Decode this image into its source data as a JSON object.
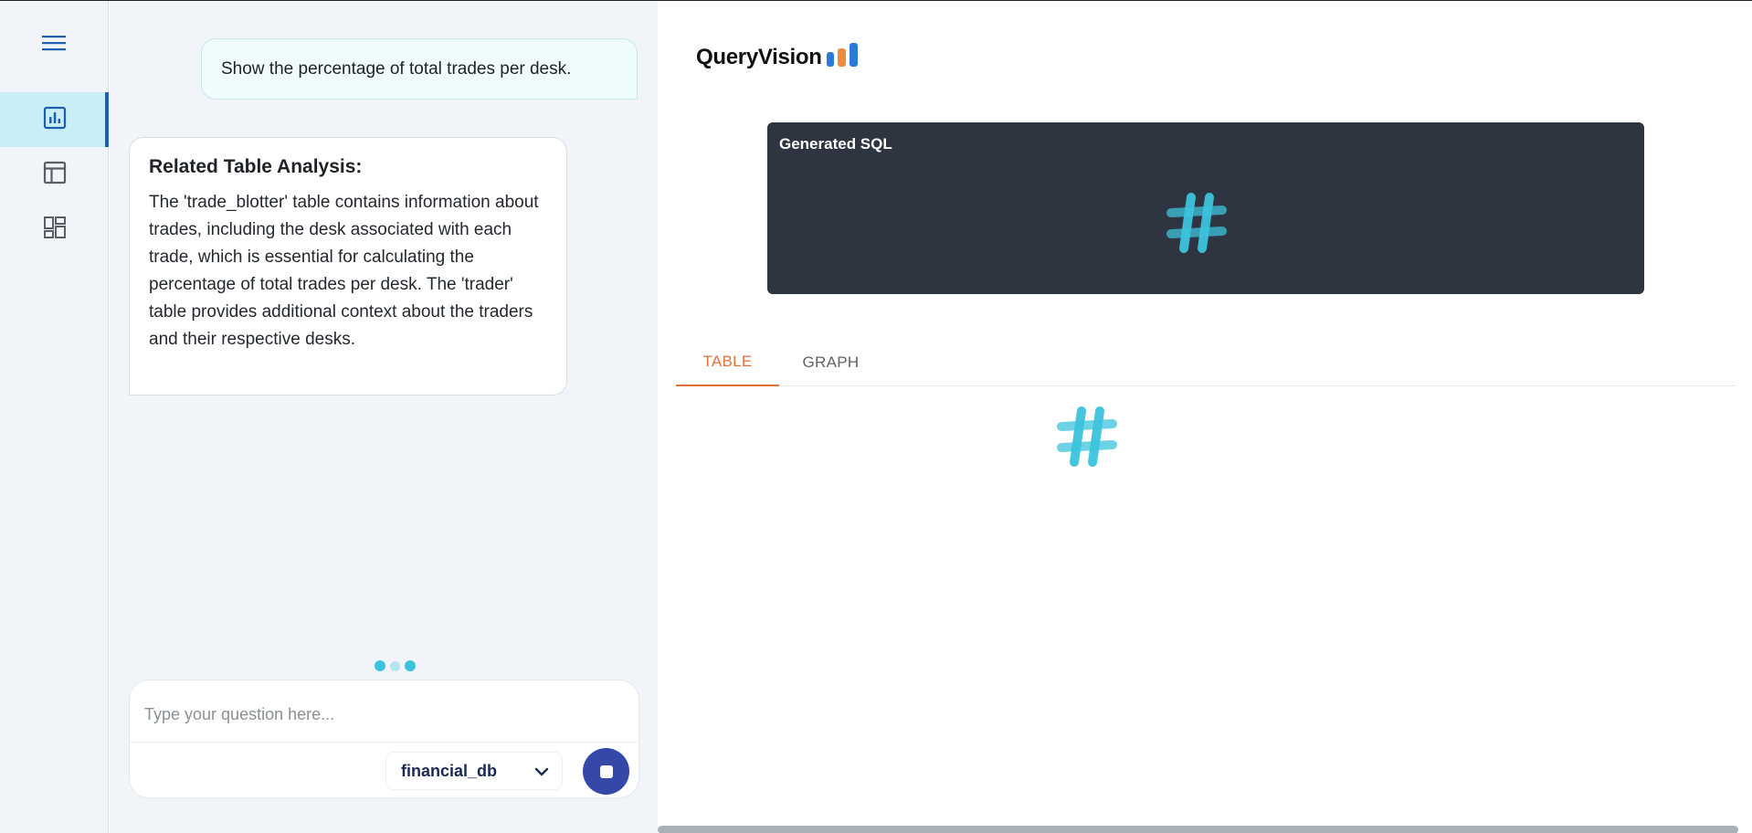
{
  "sidebar": {
    "menu_icon": "hamburger-menu-icon",
    "items": [
      {
        "icon": "bar-chart-icon",
        "active": true
      },
      {
        "icon": "table-icon",
        "active": false
      },
      {
        "icon": "dashboard-icon",
        "active": false
      }
    ]
  },
  "chat": {
    "user_message": "Show the percentage of total trades per desk.",
    "analysis": {
      "title": "Related Table Analysis:",
      "body": "The 'trade_blotter' table contains information about trades, including the desk associated with each trade, which is essential for calculating the percentage of total trades per desk. The 'trader' table provides additional context about the traders and their respective desks."
    },
    "input": {
      "placeholder": "Type your question here...",
      "value": ""
    },
    "database": {
      "selected": "financial_db"
    }
  },
  "main": {
    "logo_text": "QueryVision",
    "sql_panel": {
      "title": "Generated SQL"
    },
    "tabs": [
      {
        "label": "TABLE",
        "active": true
      },
      {
        "label": "GRAPH",
        "active": false
      }
    ]
  },
  "colors": {
    "accent": "#e2703a",
    "primary": "#3548a8",
    "spinner": "#3cc3dc",
    "sql_bg": "#2e3440",
    "sidebar_active": "#c9eef5"
  }
}
